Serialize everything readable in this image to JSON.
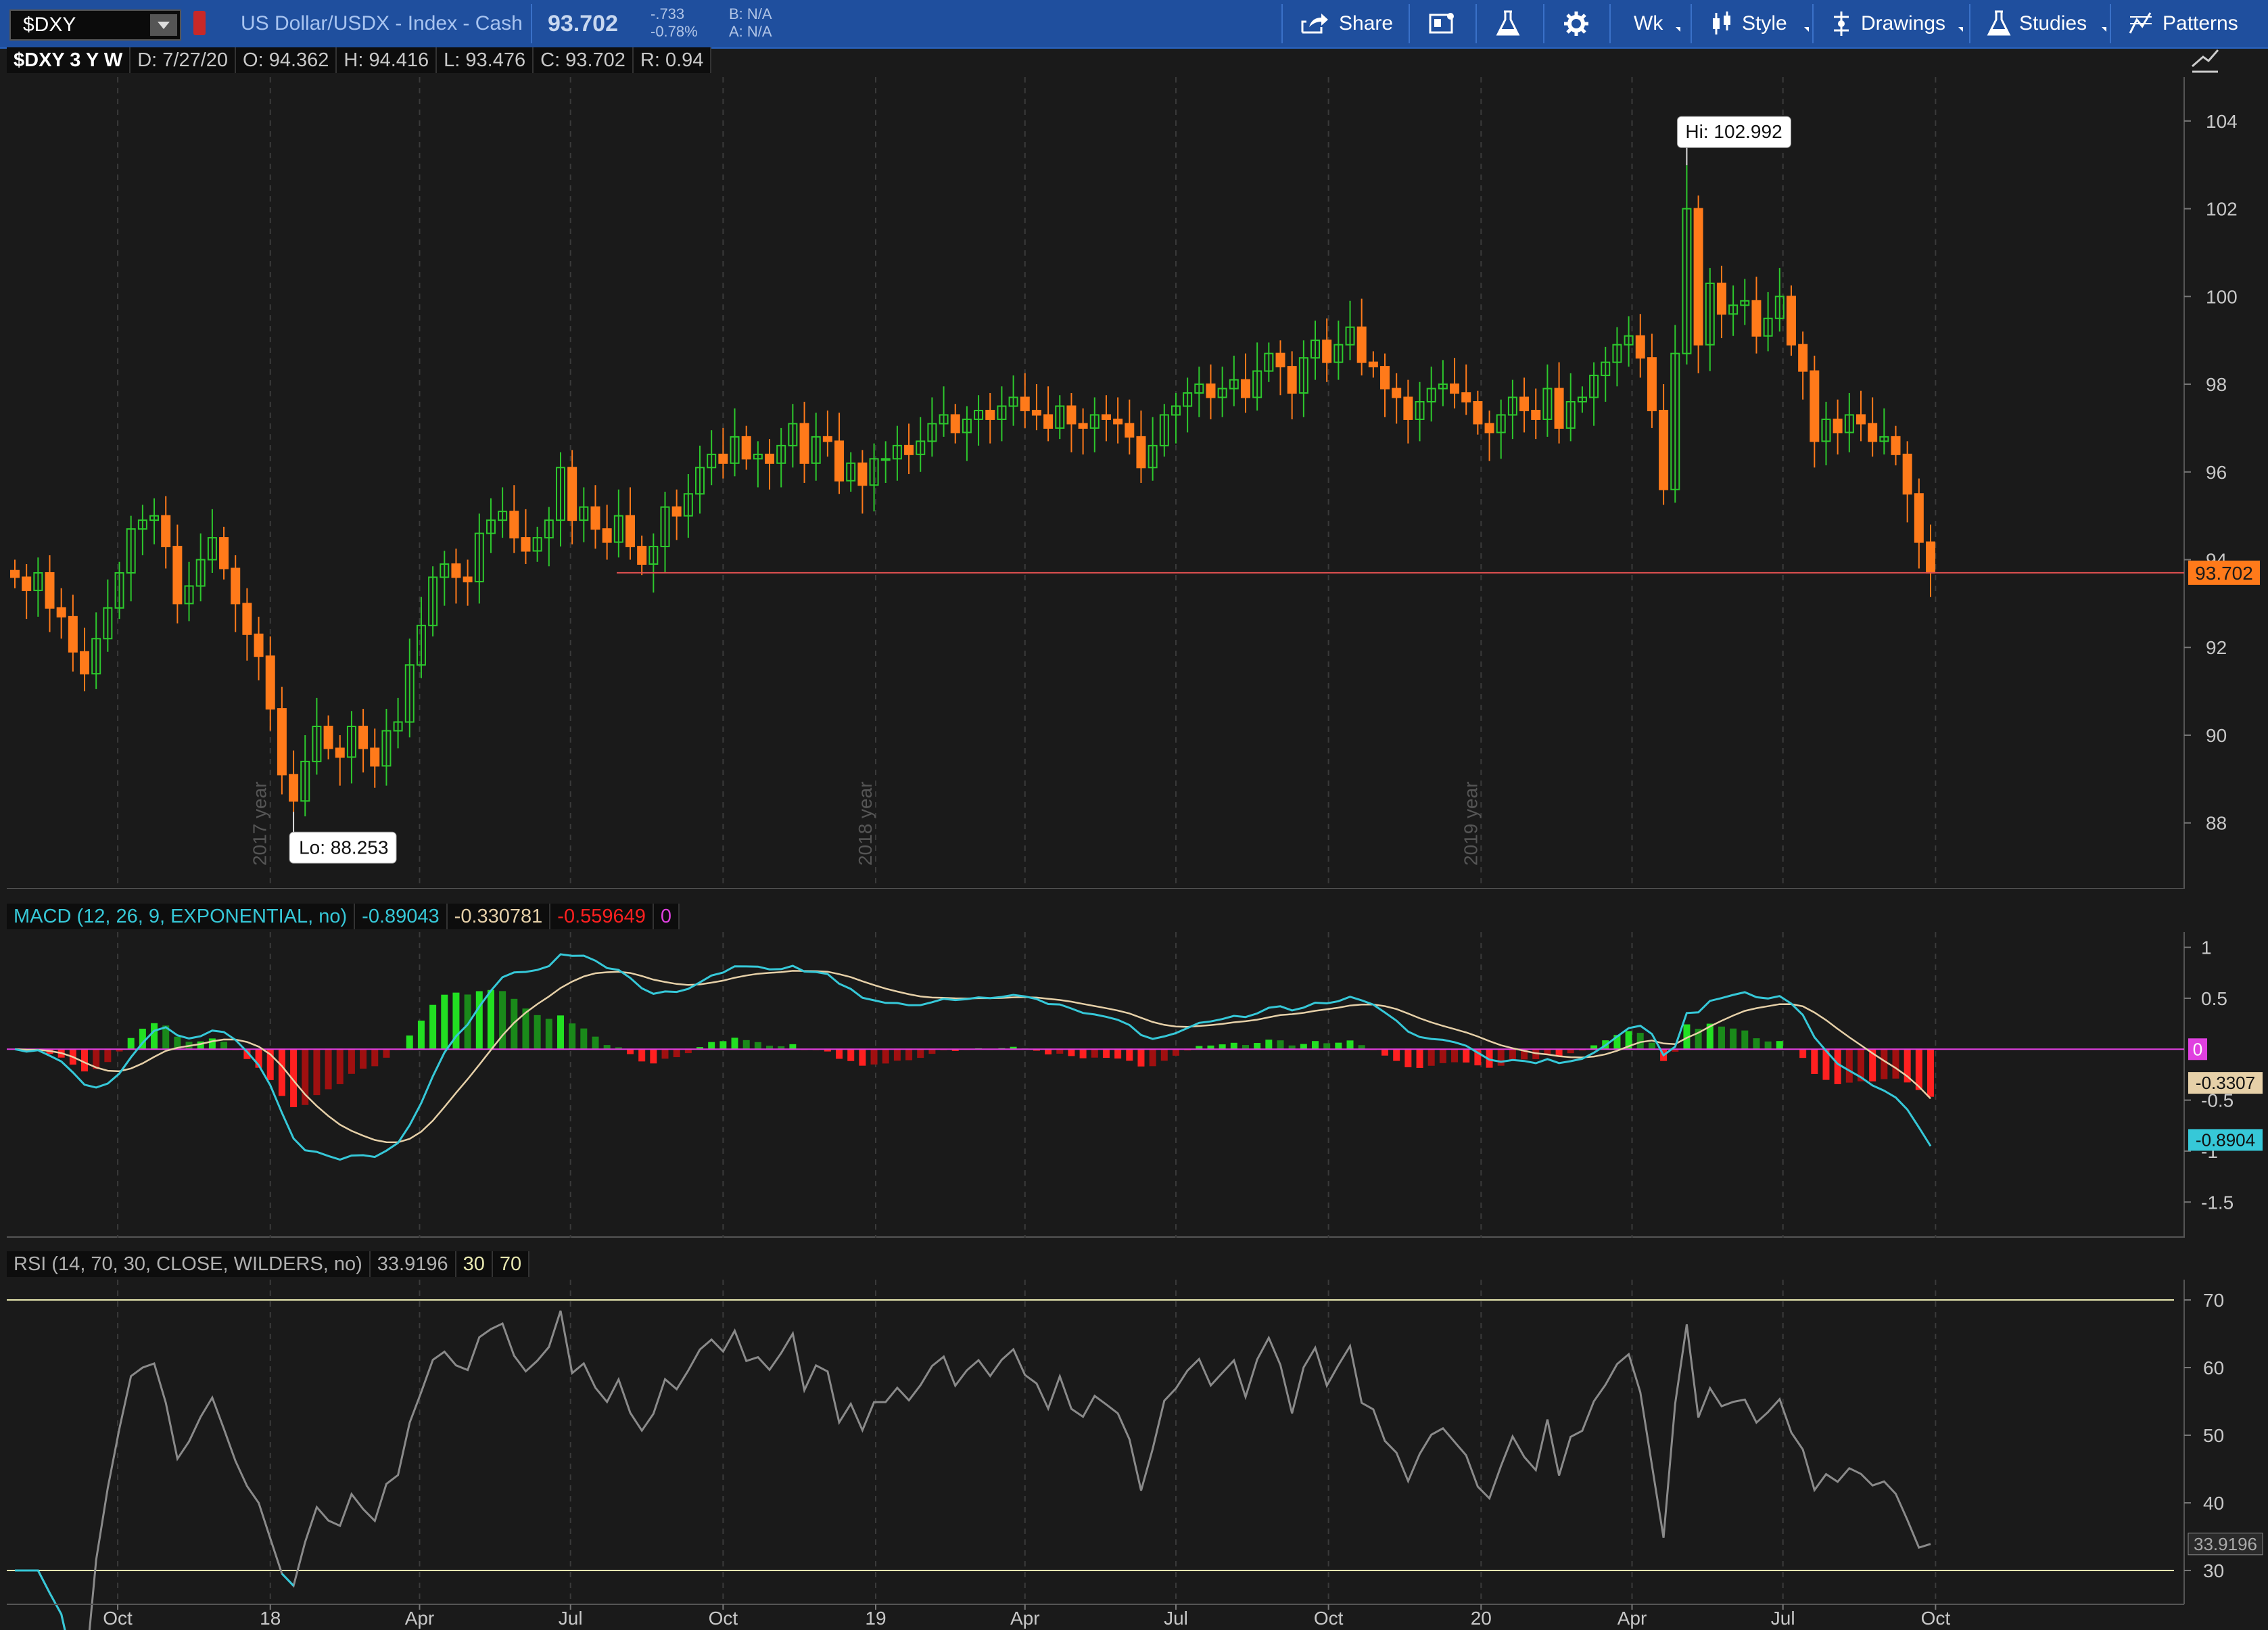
{
  "toolbar": {
    "symbol": "$DXY",
    "description": "US Dollar/USDX - Index - Cash",
    "last": "93.702",
    "change": "-.733",
    "change_pct": "-0.78%",
    "bid": "B: N/A",
    "ask": "A: N/A",
    "share_label": "Share",
    "interval_label": "Wk",
    "style_label": "Style",
    "drawings_label": "Drawings",
    "studies_label": "Studies",
    "patterns_label": "Patterns",
    "icons": [
      "share-icon",
      "notebook-icon",
      "flask-icon",
      "gear-icon",
      "candle-style-icon",
      "drawings-icon",
      "studies-flask-icon",
      "patterns-icon"
    ]
  },
  "price_header": {
    "title": "$DXY 3 Y W",
    "date": "D: 7/27/20",
    "open": "O: 94.362",
    "high": "H: 94.416",
    "low": "L: 93.476",
    "close": "C: 93.702",
    "range": "R: 0.94"
  },
  "price_chart": {
    "y_ticks": [
      "104",
      "102",
      "100",
      "98",
      "96",
      "94",
      "92",
      "90",
      "88"
    ],
    "year_labels": [
      "2017 year",
      "2018 year",
      "2019 year"
    ],
    "hi_label": "Hi: 102.992",
    "lo_label": "Lo: 88.253",
    "last_price_label": "93.702",
    "colors": {
      "up": "#2dc82d",
      "down": "#ff7a1a",
      "last_line": "#e05050",
      "bg": "#1a1a1a",
      "grid": "#3a3a3a"
    }
  },
  "macd_header": {
    "label": "MACD (12, 26, 9, EXPONENTIAL, no)",
    "value": "-0.89043",
    "avg": "-0.330781",
    "diff": "-0.559649",
    "zero": "0"
  },
  "macd_chart": {
    "y_ticks": [
      "1",
      "0.5",
      "-0.5",
      "-1",
      "-1.5"
    ],
    "zero_label": "0",
    "avg_label": "-0.3307",
    "value_label": "-0.8904",
    "colors": {
      "value": "#36c8d8",
      "avg": "#e6d0a8",
      "hist_pos": "#22e022",
      "hist_neg": "#ff2020",
      "zero": "#e040e0"
    }
  },
  "rsi_header": {
    "label": "RSI (14, 70, 30, CLOSE, WILDERS, no)",
    "value": "33.9196",
    "oversold": "30",
    "overbought": "70"
  },
  "rsi_chart": {
    "y_ticks": [
      "70",
      "60",
      "50",
      "40",
      "30"
    ],
    "value_label": "33.9196",
    "colors": {
      "line": "#8a8a8a",
      "oversold": "#36c8d8",
      "bounds": "#e8e8b0"
    }
  },
  "x_axis": {
    "labels": [
      "Oct",
      "18",
      "Apr",
      "Jul",
      "Oct",
      "19",
      "Apr",
      "Jul",
      "Oct",
      "20",
      "Apr",
      "Jul",
      "Oct"
    ]
  },
  "chart_data": [
    {
      "type": "candlestick",
      "title": "$DXY 3 Y W",
      "x_start": "2017-07-31",
      "interval": "week",
      "ylim": [
        86.5,
        105
      ],
      "close": [
        93.6,
        93.3,
        93.7,
        92.9,
        92.7,
        91.9,
        91.4,
        92.2,
        92.9,
        93.7,
        94.7,
        94.9,
        95.0,
        94.3,
        93.0,
        93.4,
        94.0,
        94.5,
        93.8,
        93.0,
        92.3,
        91.8,
        90.6,
        89.1,
        88.5,
        89.4,
        90.2,
        89.7,
        89.5,
        90.2,
        89.7,
        89.3,
        90.1,
        90.3,
        91.6,
        92.5,
        93.6,
        93.9,
        93.6,
        93.5,
        94.6,
        94.9,
        95.1,
        94.5,
        94.2,
        94.5,
        94.9,
        96.1,
        94.9,
        95.2,
        94.7,
        94.4,
        95.0,
        94.3,
        93.9,
        94.3,
        95.2,
        95.0,
        95.5,
        96.1,
        96.4,
        96.2,
        96.8,
        96.3,
        96.4,
        96.2,
        96.6,
        97.1,
        96.2,
        96.8,
        96.7,
        95.8,
        96.2,
        95.7,
        96.3,
        96.3,
        96.6,
        96.4,
        96.7,
        97.1,
        97.3,
        96.9,
        97.2,
        97.4,
        97.2,
        97.5,
        97.7,
        97.4,
        97.3,
        97.0,
        97.5,
        97.1,
        97.0,
        97.3,
        97.2,
        97.1,
        96.8,
        96.1,
        96.6,
        97.3,
        97.5,
        97.8,
        98.0,
        97.7,
        97.9,
        98.1,
        97.7,
        98.3,
        98.7,
        98.4,
        97.8,
        98.6,
        99.0,
        98.5,
        98.9,
        99.3,
        98.5,
        98.4,
        97.9,
        97.7,
        97.2,
        97.6,
        97.9,
        98.0,
        97.8,
        97.6,
        97.1,
        96.9,
        97.3,
        97.7,
        97.4,
        97.2,
        97.9,
        97.0,
        97.6,
        97.7,
        98.2,
        98.5,
        98.9,
        99.1,
        98.6,
        97.4,
        95.6,
        98.7,
        102.0,
        98.9,
        100.3,
        99.6,
        99.8,
        99.9,
        99.1,
        99.5,
        100.0,
        98.9,
        98.3,
        96.7,
        97.2,
        96.9,
        97.3,
        97.1,
        96.7,
        96.8,
        96.4,
        95.5,
        94.4,
        93.7
      ],
      "hi": 102.992,
      "lo": 88.253,
      "last": 93.702
    },
    {
      "type": "line",
      "title": "MACD (12, 26, 9, EXPONENTIAL, no)",
      "ylim": [
        -1.85,
        1.15
      ],
      "series_names": [
        "value",
        "avg",
        "diff"
      ],
      "last": {
        "value": -0.89043,
        "avg": -0.330781,
        "diff": -0.559649
      }
    },
    {
      "type": "line",
      "title": "RSI (14, 70, 30, CLOSE, WILDERS, no)",
      "ylim": [
        25,
        73
      ],
      "levels": [
        30,
        70
      ],
      "last": 33.9196
    }
  ]
}
